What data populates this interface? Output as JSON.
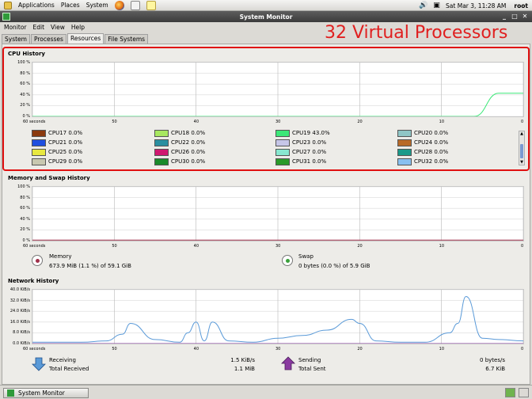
{
  "top_panel": {
    "menus": [
      "Applications",
      "Places",
      "System"
    ],
    "clock": "Sat Mar  3, 11:28 AM",
    "user": "root"
  },
  "window": {
    "title": "System Monitor",
    "menubar": [
      "Monitor",
      "Edit",
      "View",
      "Help"
    ],
    "tabs": [
      {
        "label": "System",
        "active": false
      },
      {
        "label": "Processes",
        "active": false
      },
      {
        "label": "Resources",
        "active": true
      },
      {
        "label": "File Systems",
        "active": false
      }
    ]
  },
  "annotation": "32 Virtual Processors",
  "cpu": {
    "title": "CPU History",
    "y_ticks": [
      "100 %",
      "80 %",
      "60 %",
      "40 %",
      "20 %",
      "0 %"
    ],
    "x_ticks": [
      "60 seconds",
      "50",
      "40",
      "30",
      "20",
      "10",
      "0"
    ],
    "legend": [
      {
        "label": "CPU17",
        "value": "0.0%",
        "color": "#8b3a0e"
      },
      {
        "label": "CPU18",
        "value": "0.0%",
        "color": "#a8e860"
      },
      {
        "label": "CPU19",
        "value": "43.0%",
        "color": "#3ce878"
      },
      {
        "label": "CPU20",
        "value": "0.0%",
        "color": "#8fc6c6"
      },
      {
        "label": "CPU21",
        "value": "0.0%",
        "color": "#1f4fe0"
      },
      {
        "label": "CPU22",
        "value": "0.0%",
        "color": "#2a8fa0"
      },
      {
        "label": "CPU23",
        "value": "0.0%",
        "color": "#c6c6e8"
      },
      {
        "label": "CPU24",
        "value": "0.0%",
        "color": "#b86a28"
      },
      {
        "label": "CPU25",
        "value": "0.0%",
        "color": "#e8e840"
      },
      {
        "label": "CPU26",
        "value": "0.0%",
        "color": "#d01870"
      },
      {
        "label": "CPU27",
        "value": "0.0%",
        "color": "#88e8d0"
      },
      {
        "label": "CPU28",
        "value": "0.0%",
        "color": "#1a9a8a"
      },
      {
        "label": "CPU29",
        "value": "0.0%",
        "color": "#c8c8b0"
      },
      {
        "label": "CPU30",
        "value": "0.0%",
        "color": "#1a8a2a"
      },
      {
        "label": "CPU31",
        "value": "0.0%",
        "color": "#2a9a2a"
      },
      {
        "label": "CPU32",
        "value": "0.0%",
        "color": "#88c0f0"
      }
    ],
    "scroll_up": "▲",
    "scroll_down": "▼"
  },
  "memory": {
    "title": "Memory and Swap History",
    "y_ticks": [
      "100 %",
      "80 %",
      "60 %",
      "40 %",
      "20 %",
      "0 %"
    ],
    "x_ticks": [
      "60 seconds",
      "50",
      "40",
      "30",
      "20",
      "10",
      "0"
    ],
    "memory_label": "Memory",
    "memory_value": "673.9 MiB (1.1 %) of 59.1 GiB",
    "swap_label": "Swap",
    "swap_value": "0 bytes (0.0 %) of 5.9 GiB",
    "memory_color": "#a0304a",
    "swap_color": "#3aa03a"
  },
  "network": {
    "title": "Network History",
    "y_ticks": [
      "40.0 KiB/s",
      "32.0 KiB/s",
      "24.0 KiB/s",
      "16.0 KiB/s",
      "8.0 KiB/s",
      "0.0 KiB/s"
    ],
    "x_ticks": [
      "60 seconds",
      "50",
      "40",
      "30",
      "20",
      "10",
      "0"
    ],
    "receiving_label": "Receiving",
    "receiving_value": "1.5 KiB/s",
    "total_received_label": "Total Received",
    "total_received_value": "1.1 MiB",
    "sending_label": "Sending",
    "sending_value": "0 bytes/s",
    "total_sent_label": "Total Sent",
    "total_sent_value": "6.7 KiB",
    "receive_color": "#5a9ad8",
    "send_color": "#8a3aa0"
  },
  "chart_data": [
    {
      "type": "line",
      "title": "CPU History",
      "x": [
        60,
        57,
        54,
        51,
        48,
        45,
        42,
        39,
        36,
        33,
        30,
        27,
        24,
        21,
        18,
        15,
        12,
        9,
        6,
        3,
        0
      ],
      "ylim": [
        0,
        100
      ],
      "series": [
        {
          "name": "CPU19",
          "values": [
            0,
            0,
            0,
            0,
            0,
            0,
            0,
            0,
            0,
            0,
            0,
            0,
            0,
            0,
            0,
            0,
            0,
            0,
            0,
            43,
            43
          ]
        }
      ]
    },
    {
      "type": "line",
      "title": "Network History",
      "x": [
        60,
        57,
        54,
        51,
        49,
        48,
        45,
        42,
        41,
        40,
        39,
        38,
        36,
        33,
        30,
        27,
        24,
        21,
        20,
        18,
        15,
        12,
        9,
        8,
        7,
        5,
        3,
        0
      ],
      "ylim": [
        0,
        40
      ],
      "series": [
        {
          "name": "Receiving",
          "values": [
            1,
            1,
            1,
            2,
            7,
            15,
            3,
            1,
            8,
            16,
            2,
            16,
            2,
            1,
            4,
            6,
            10,
            18,
            15,
            2,
            1,
            1,
            8,
            15,
            35,
            4,
            3,
            2
          ]
        },
        {
          "name": "Sending",
          "values": [
            0,
            0,
            0,
            0,
            0,
            0,
            0,
            0,
            0,
            0,
            0,
            0,
            0,
            0,
            0,
            0,
            0,
            0,
            0,
            0,
            0,
            0,
            0,
            0,
            0,
            0,
            0,
            0
          ]
        }
      ]
    }
  ]
}
